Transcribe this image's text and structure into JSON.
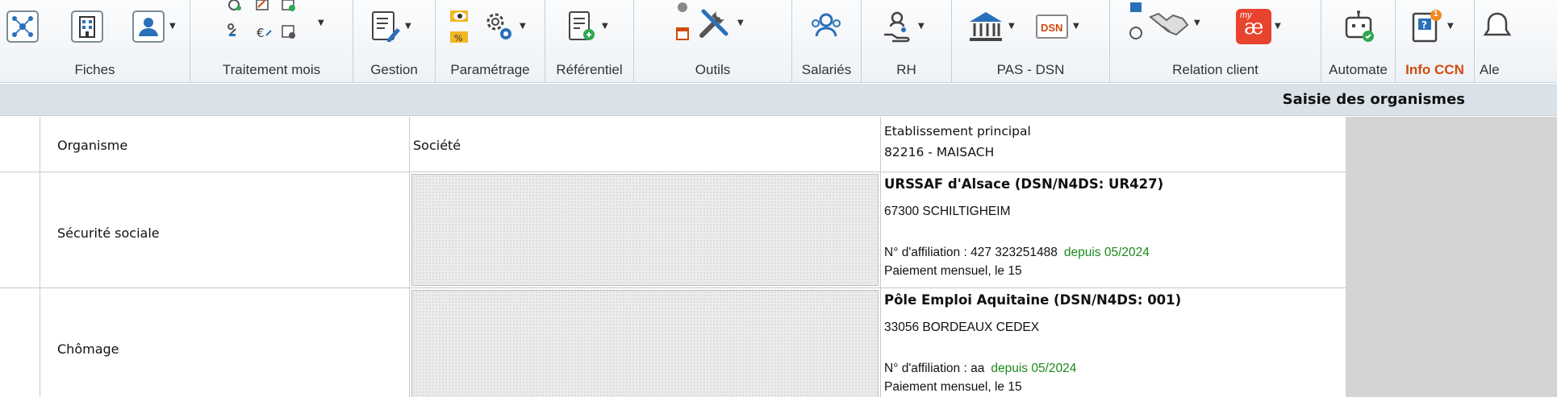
{
  "ribbon": {
    "groups": [
      {
        "id": "fiches",
        "label": "Fiches"
      },
      {
        "id": "traitement",
        "label": "Traitement mois"
      },
      {
        "id": "gestion",
        "label": "Gestion"
      },
      {
        "id": "parametrage",
        "label": "Paramétrage"
      },
      {
        "id": "referentiel",
        "label": "Référentiel"
      },
      {
        "id": "outils",
        "label": "Outils"
      },
      {
        "id": "salaries",
        "label": "Salariés"
      },
      {
        "id": "rh",
        "label": "RH"
      },
      {
        "id": "pas_dsn",
        "label": "PAS - DSN"
      },
      {
        "id": "relation",
        "label": "Relation client"
      },
      {
        "id": "automate",
        "label": "Automate"
      },
      {
        "id": "info_ccn",
        "label": "Info CCN"
      },
      {
        "id": "alertes",
        "label": "Ale"
      }
    ],
    "dsn_badge": "DSN",
    "myae_badge": "my",
    "myae_logo": "æ",
    "notification_count": "1",
    "accent_color": "#d04b0c",
    "icons": [
      "network-icon",
      "building-icon",
      "user-card-icon",
      "monthly-processing-icon",
      "checklist-edit-icon",
      "settings-eye-icon",
      "gears-icon",
      "reference-doc-icon",
      "tools-icon",
      "employees-icon",
      "hr-hand-icon",
      "bank-icon",
      "dsn-icon",
      "handshake-icon",
      "myae-icon",
      "robot-icon",
      "ccn-book-icon",
      "alert-icon"
    ]
  },
  "page": {
    "title": "Saisie des organismes"
  },
  "table": {
    "headers": {
      "organisme": "Organisme",
      "societe": "Société",
      "etablissement_title": "Etablissement principal",
      "etablissement_value": "82216 - MAISACH"
    },
    "rows": [
      {
        "label": "Sécurité sociale",
        "org_name": "URSSAF d'Alsace (DSN/N4DS: UR427)",
        "address": "67300 SCHILTIGHEIM",
        "affiliation": "N° d'affiliation : 427 323251488",
        "since": "depuis 05/2024",
        "payment": "Paiement mensuel, le 15"
      },
      {
        "label": "Chômage",
        "org_name": "Pôle Emploi Aquitaine (DSN/N4DS: 001)",
        "address": "33056 BORDEAUX CEDEX",
        "affiliation": "N° d'affiliation : aa",
        "since": "depuis 05/2024",
        "payment": "Paiement mensuel, le 15"
      }
    ]
  }
}
